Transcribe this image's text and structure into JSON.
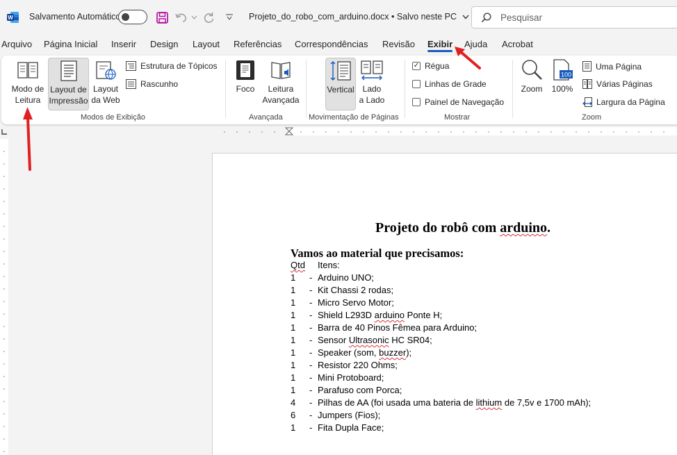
{
  "titlebar": {
    "autosave_label": "Salvamento Automático",
    "doc_title": "Projeto_do_robo_com_arduino.docx • Salvo neste PC",
    "search_placeholder": "Pesquisar"
  },
  "tabs": [
    "Arquivo",
    "Página Inicial",
    "Inserir",
    "Design",
    "Layout",
    "Referências",
    "Correspondências",
    "Revisão",
    "Exibir",
    "Ajuda",
    "Acrobat"
  ],
  "active_tab": "Exibir",
  "ribbon": {
    "modos": {
      "leitura": "Modo de\nLeitura",
      "impressao": "Layout de\nImpressão",
      "web": "Layout\nda Web",
      "estrutura": "Estrutura de Tópicos",
      "rascunho": "Rascunho",
      "group": "Modos de Exibição"
    },
    "avancada": {
      "foco": "Foco",
      "leitura_avancada": "Leitura\nAvançada",
      "group": "Avançada"
    },
    "movimentacao": {
      "vertical": "Vertical",
      "lado": "Lado\na Lado",
      "group": "Movimentação de Páginas"
    },
    "mostrar": {
      "regua": "Régua",
      "linhas": "Linhas de Grade",
      "painel": "Painel de Navegação",
      "regua_checked": true,
      "linhas_checked": false,
      "painel_checked": false,
      "group": "Mostrar"
    },
    "zoom": {
      "zoom": "Zoom",
      "pct": "100%",
      "pct_icon": "100",
      "uma": "Uma Página",
      "varias": "Várias Páginas",
      "largura": "Largura da Página",
      "group": "Zoom"
    }
  },
  "document": {
    "heading_pre": "Projeto do robô com ",
    "heading_squig": "arduino",
    "heading_post": ".",
    "subheading": "Vamos ao material que precisamos:",
    "col_qty": "Qtd",
    "col_items": "Itens:",
    "items": [
      {
        "qty": "1",
        "pre": "Arduino UNO;",
        "squig": "",
        "post": ""
      },
      {
        "qty": "1",
        "pre": "Kit Chassi 2 rodas;",
        "squig": "",
        "post": ""
      },
      {
        "qty": "1",
        "pre": "Micro Servo Motor;",
        "squig": "",
        "post": ""
      },
      {
        "qty": "1",
        "pre": "Shield L293D ",
        "squig": "arduino",
        "post": " Ponte H;"
      },
      {
        "qty": "1",
        "pre": "Barra de 40 Pinos Fêmea para Arduino;",
        "squig": "",
        "post": ""
      },
      {
        "qty": "1",
        "pre": "Sensor ",
        "squig": "Ultrasonic",
        "post": " HC SR04;"
      },
      {
        "qty": "1",
        "pre": "Speaker (som, ",
        "squig": "buzzer",
        "post": ");"
      },
      {
        "qty": "1",
        "pre": "Resistor 220 Ohms;",
        "squig": "",
        "post": ""
      },
      {
        "qty": "1",
        "pre": "Mini Protoboard;",
        "squig": "",
        "post": ""
      },
      {
        "qty": "1",
        "pre": "Parafuso com Porca;",
        "squig": "",
        "post": ""
      },
      {
        "qty": "4",
        "pre": "Pilhas de AA (foi usada uma bateria de ",
        "squig": "lithium",
        "post": " de 7,5v e 1700 mAh);"
      },
      {
        "qty": "6",
        "pre": "Jumpers (Fios);",
        "squig": "",
        "post": ""
      },
      {
        "qty": "1",
        "pre": "Fita Dupla Face;",
        "squig": "",
        "post": ""
      }
    ]
  },
  "colors": {
    "accent": "#185abd",
    "annotation_arrow": "#e02020",
    "save_icon": "#b4009e"
  }
}
